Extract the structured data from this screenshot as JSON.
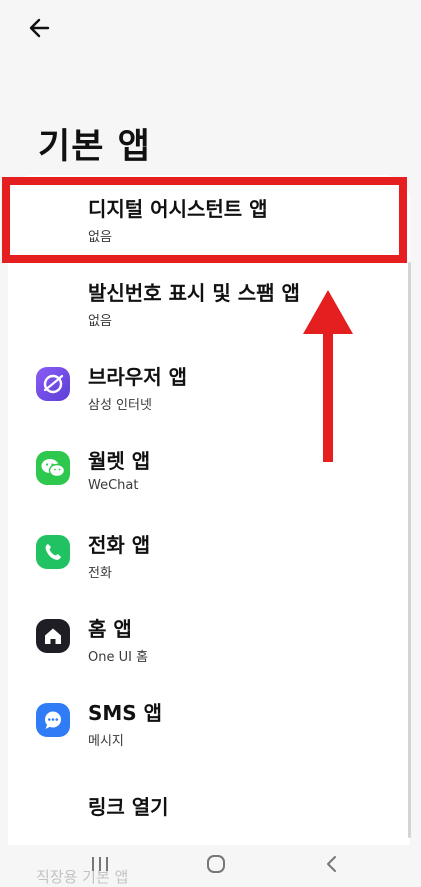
{
  "header": {
    "title": "기본 앱"
  },
  "items": [
    {
      "title": "디지털 어시스턴트 앱",
      "sub": "없음"
    },
    {
      "title": "발신번호 표시 및 스팸 앱",
      "sub": "없음"
    },
    {
      "title": "브라우저 앱",
      "sub": "삼성 인터넷",
      "icon": "samsung-internet-icon"
    },
    {
      "title": "월렛 앱",
      "sub": "WeChat",
      "icon": "wechat-icon"
    },
    {
      "title": "전화 앱",
      "sub": "전화",
      "icon": "phone-icon"
    },
    {
      "title": "홈 앱",
      "sub": "One UI 홈",
      "icon": "home-icon"
    },
    {
      "title": "SMS 앱",
      "sub": "메시지",
      "icon": "messages-icon"
    },
    {
      "title": "링크 열기"
    }
  ],
  "partial_item": "직장용 기본 앱",
  "colors": {
    "highlight": "#e51f1f",
    "background": "#f6f6f6",
    "card": "#ffffff"
  }
}
